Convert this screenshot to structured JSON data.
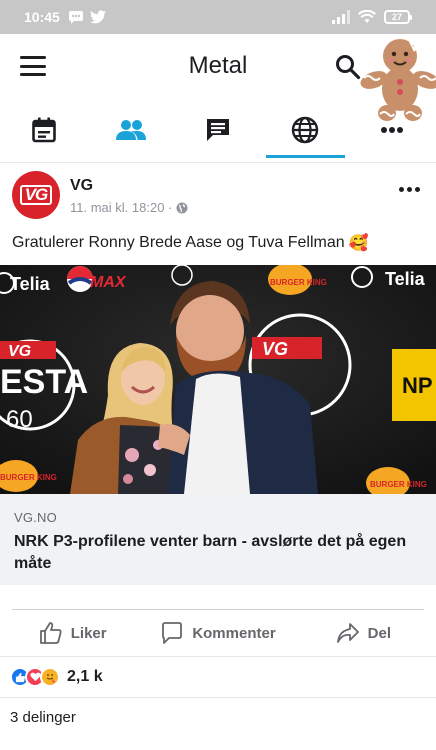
{
  "status_bar": {
    "time": "10:45",
    "battery": "27"
  },
  "header": {
    "title": "Metal"
  },
  "tabs": [
    {
      "name": "events",
      "icon": "calendar-icon"
    },
    {
      "name": "groups",
      "icon": "groups-icon"
    },
    {
      "name": "messages",
      "icon": "messages-icon"
    },
    {
      "name": "explore",
      "icon": "globe-icon",
      "active": true
    },
    {
      "name": "more",
      "icon": "more-icon"
    }
  ],
  "post": {
    "author": "VG",
    "avatar_label": "VG",
    "timestamp": "11. mai kl. 18:20 ·",
    "text": "Gratulerer Ronny Brede Aase og Tuva Fellman",
    "emoji": "🥰",
    "link": {
      "domain": "VG.NO",
      "headline": "NRK P3-profilene venter barn - avslørte det på egen måte",
      "image_banner": {
        "telia": "Telia",
        "vg": "VG",
        "pepsi": "MAX",
        "burger_king": "BURGER KING",
        "telia_right": "Telia",
        "vg_center": "VG",
        "esta": "ESTA",
        "sixty": "60",
        "burger_king_2": "BURGER KING",
        "burger_king_3": "BURGER KING",
        "np": "NP"
      }
    },
    "actions": {
      "like": "Liker",
      "comment": "Kommenter",
      "share": "Del"
    },
    "reactions_count": "2,1 k",
    "shares": "3 delinger"
  },
  "colors": {
    "accent": "#1aa3d8",
    "vg_red": "#d8232a",
    "like_blue": "#1877f2",
    "love_red": "#f33e58",
    "haha_yellow": "#f7b125"
  }
}
